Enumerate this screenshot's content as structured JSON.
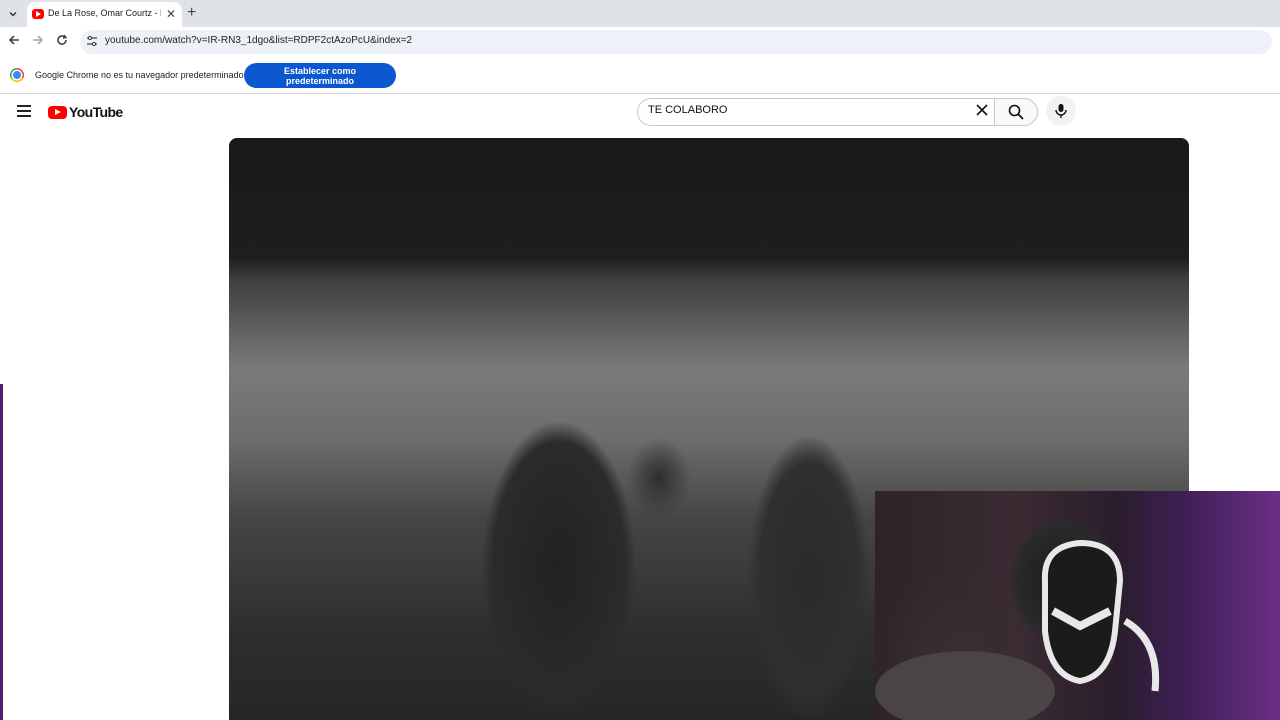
{
  "browser": {
    "tab": {
      "title": "De La Rose, Omar Courtz - NUE"
    },
    "address_bar": {
      "url": "youtube.com/watch?v=IR-RN3_1dgo&list=RDPF2ctAzoPcU&index=2"
    }
  },
  "infobar": {
    "message": "Google Chrome no es tu navegador predeterminado",
    "set_default_label": "Establecer como predeterminado"
  },
  "youtube": {
    "logo_text": "YouTube",
    "search": {
      "value": "TE COLABORO"
    }
  },
  "colors": {
    "youtube_red": "#ff0000",
    "chrome_blue_button": "#0b57d0"
  }
}
